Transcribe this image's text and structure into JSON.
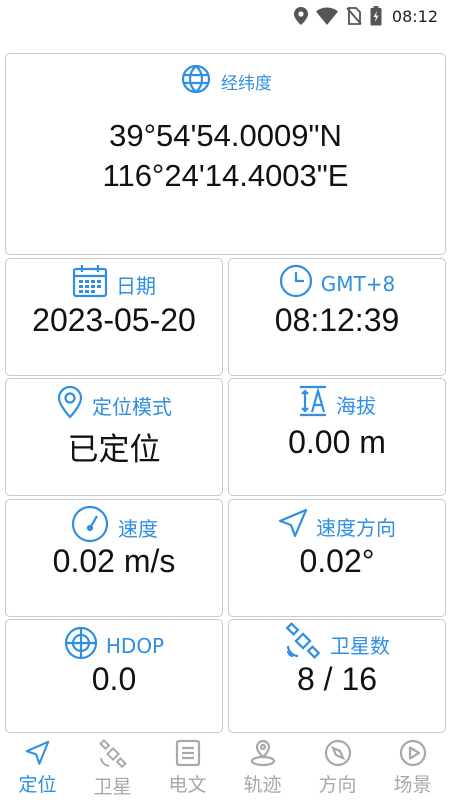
{
  "status_bar": {
    "time": "08:12",
    "icons": [
      "location-icon",
      "wifi-icon",
      "no-sim-icon",
      "battery-charging-icon"
    ]
  },
  "coordinates": {
    "label": "经纬度",
    "icon": "globe-icon",
    "latitude": "39°54'54.0009\"N",
    "longitude": "116°24'14.4003\"E"
  },
  "cards": {
    "date": {
      "label": "日期",
      "icon": "calendar-icon",
      "value": "2023-05-20"
    },
    "time": {
      "label": "GMT+8",
      "icon": "clock-icon",
      "value": "08:12:39"
    },
    "mode": {
      "label": "定位模式",
      "icon": "location-pin-icon",
      "value": "已定位"
    },
    "altitude": {
      "label": "海拔",
      "icon": "altitude-icon",
      "value": "0.00 m"
    },
    "speed": {
      "label": "速度",
      "icon": "speedometer-icon",
      "value": "0.02 m/s"
    },
    "heading": {
      "label": "速度方向",
      "icon": "navigation-arrow-icon",
      "value": "0.02°"
    },
    "hdop": {
      "label": "HDOP",
      "icon": "crosshair-icon",
      "value": "0.0"
    },
    "satellites": {
      "label": "卫星数",
      "icon": "satellite-icon",
      "value": "8 / 16"
    }
  },
  "tabs": [
    {
      "label": "定位",
      "icon": "navigation-arrow-icon",
      "active": true
    },
    {
      "label": "卫星",
      "icon": "satellite-icon",
      "active": false
    },
    {
      "label": "电文",
      "icon": "document-icon",
      "active": false
    },
    {
      "label": "轨迹",
      "icon": "track-pin-icon",
      "active": false
    },
    {
      "label": "方向",
      "icon": "compass-icon",
      "active": false
    },
    {
      "label": "场景",
      "icon": "play-circle-icon",
      "active": false
    }
  ],
  "colors": {
    "accent": "#2f8fe3",
    "inactive": "#a8a8a8",
    "border": "#c9c9c9",
    "text": "#111111"
  }
}
